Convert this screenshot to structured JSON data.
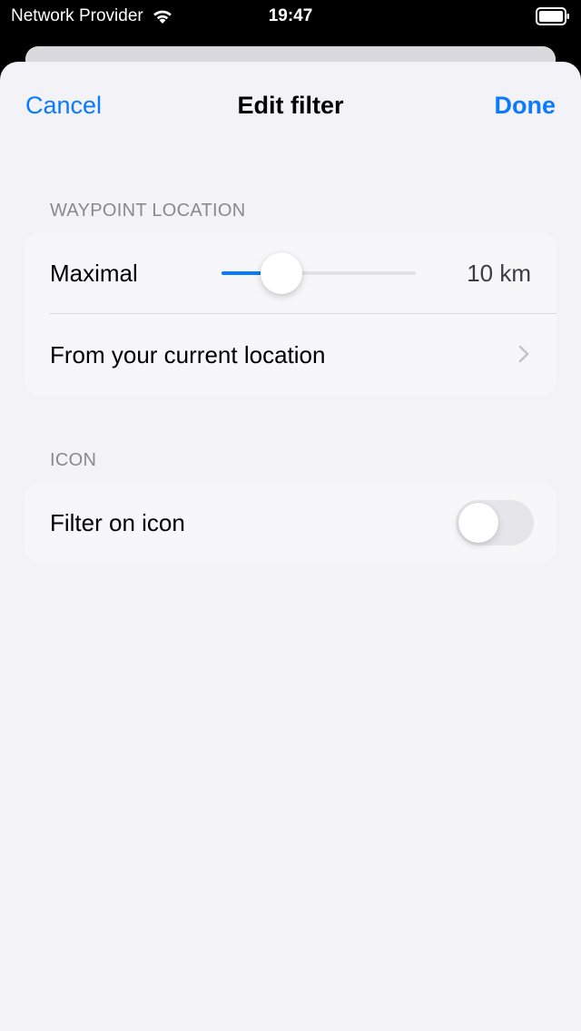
{
  "status_bar": {
    "carrier": "Network Provider",
    "time": "19:47",
    "icons": [
      "wifi-icon",
      "battery-icon"
    ]
  },
  "nav": {
    "cancel_label": "Cancel",
    "title": "Edit filter",
    "done_label": "Done"
  },
  "sections": {
    "waypoint": {
      "header": "WAYPOINT LOCATION",
      "maximal_label": "Maximal",
      "slider_fraction": 0.31,
      "distance_value": "10 km",
      "from_location_label": "From your current location"
    },
    "icon": {
      "header": "ICON",
      "filter_label": "Filter on icon",
      "toggle_on": false
    }
  },
  "colors": {
    "accent": "#0a7aff",
    "background": "#f2f2f7"
  }
}
